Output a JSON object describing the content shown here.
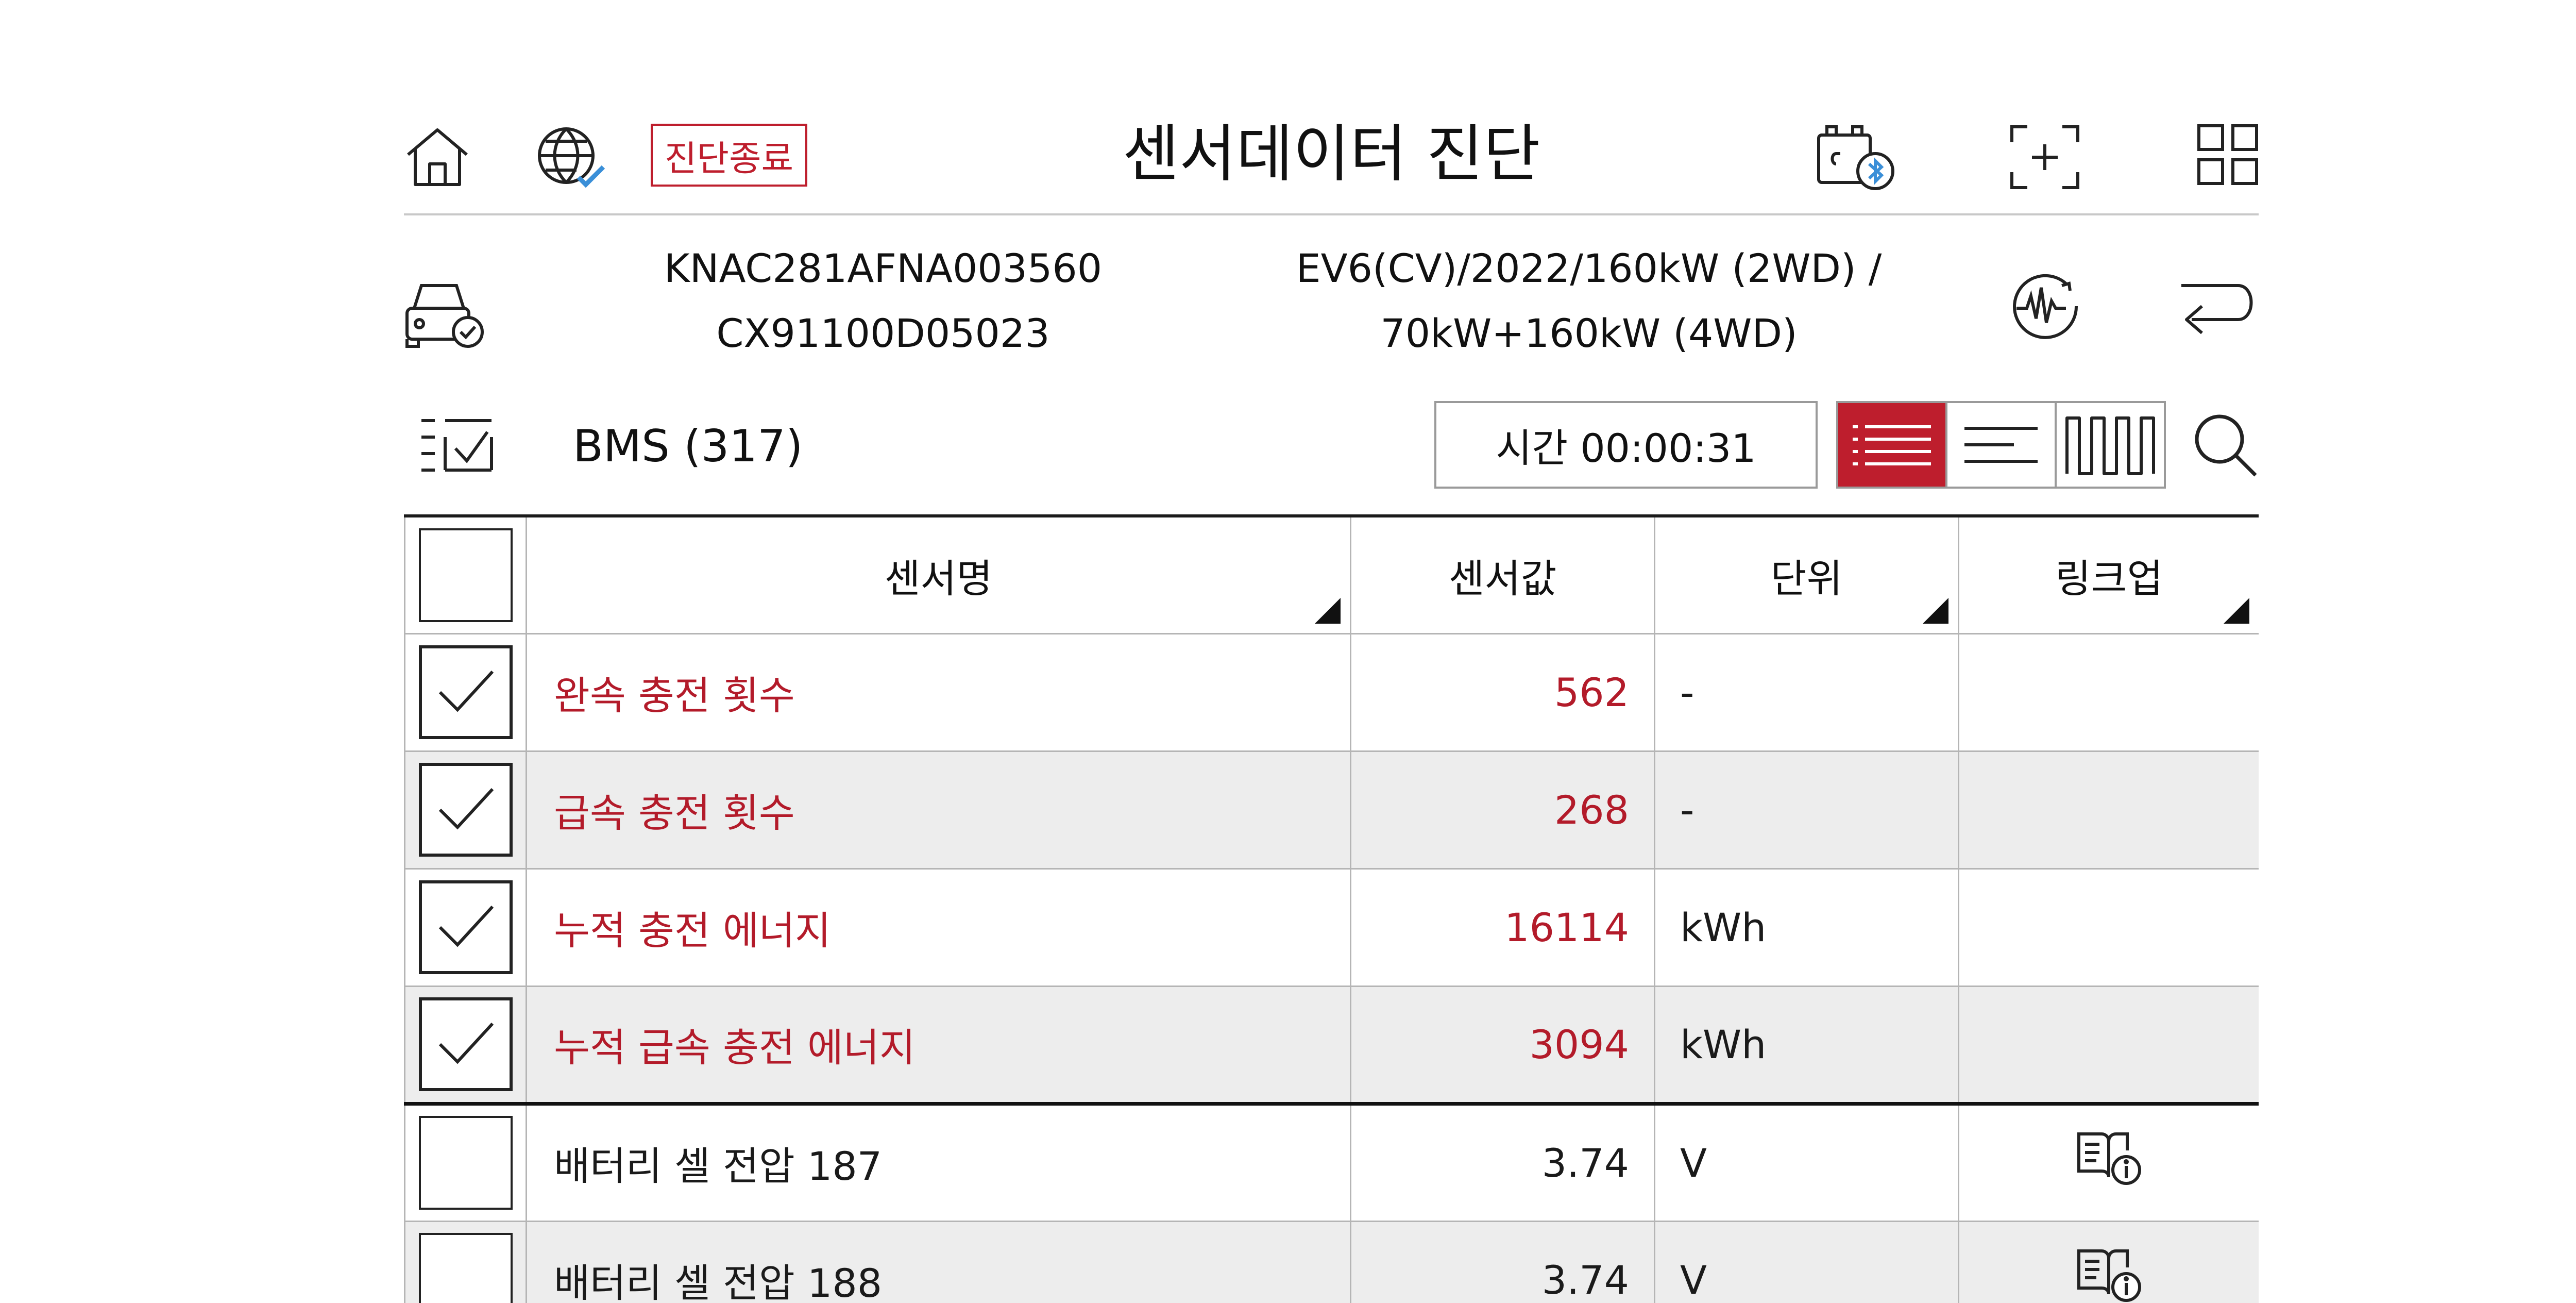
{
  "header": {
    "title": "센서데이터 진단",
    "end_button": "진단종료",
    "icons": [
      "home-icon",
      "globe-check-icon",
      "vci-bluetooth-icon",
      "screen-capture-icon",
      "grid-menu-icon"
    ]
  },
  "vehicle": {
    "vin": "KNAC281AFNA003560",
    "software": "CX91100D05023",
    "model_line1": "EV6(CV)/2022/160kW (2WD) /",
    "model_line2": "70kW+160kW (4WD)"
  },
  "toolbar": {
    "module": "BMS (317)",
    "timer": "시간 00:00:31"
  },
  "table": {
    "columns": {
      "name": "센서명",
      "value": "센서값",
      "unit": "단위",
      "link": "링크업"
    },
    "rows": [
      {
        "name": "완속 충전 횟수",
        "value": "562",
        "unit": "-",
        "checked": true,
        "link_icon": false
      },
      {
        "name": "급속 충전 횟수",
        "value": "268",
        "unit": "-",
        "checked": true,
        "link_icon": false
      },
      {
        "name": "누적 충전 에너지",
        "value": "16114",
        "unit": "kWh",
        "checked": true,
        "link_icon": false
      },
      {
        "name": "누적 급속 충전 에너지",
        "value": "3094",
        "unit": "kWh",
        "checked": true,
        "link_icon": false
      },
      {
        "name": "배터리 셀 전압 187",
        "value": "3.74",
        "unit": "V",
        "checked": false,
        "link_icon": true
      },
      {
        "name": "배터리 셀 전압 188",
        "value": "3.74",
        "unit": "V",
        "checked": false,
        "link_icon": true
      }
    ]
  },
  "colors": {
    "accent": "#be1e2d",
    "selected_text": "#b31b2a",
    "row_alt": "#ededed"
  }
}
